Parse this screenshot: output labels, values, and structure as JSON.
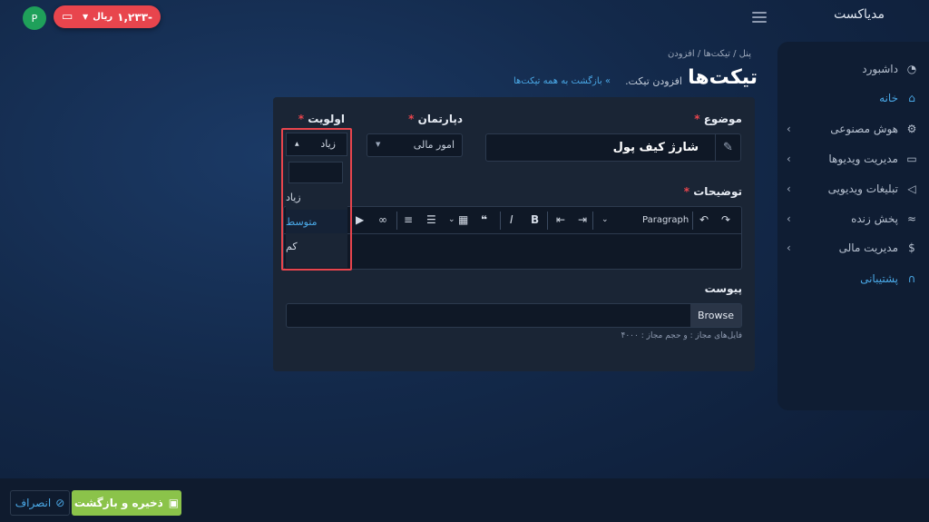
{
  "topbar": {
    "avatar_letter": "P",
    "wallet_amount": "-۱,۲۳۳",
    "wallet_currency": "ریال",
    "brand": "مدیاکست"
  },
  "sidebar": {
    "items": [
      {
        "label": "داشبورد",
        "icon": "speedometer-icon"
      },
      {
        "label": "خانه",
        "icon": "home-icon",
        "active": true
      },
      {
        "label": "هوش مصنوعی",
        "icon": "robot-icon",
        "has_chevron": true
      },
      {
        "label": "مدیریت ویدیوها",
        "icon": "video-camera-icon",
        "has_chevron": true
      },
      {
        "label": "تبلیغات ویدیویی",
        "icon": "megaphone-icon",
        "has_chevron": true
      },
      {
        "label": "پخش زنده",
        "icon": "wifi-icon",
        "has_chevron": true
      },
      {
        "label": "مدیریت مالی",
        "icon": "dollar-icon",
        "has_chevron": true
      },
      {
        "label": "پشتیبانی",
        "icon": "headset-icon",
        "active": true
      }
    ]
  },
  "breadcrumb": {
    "items": [
      "پنل",
      "تیکت‌ها",
      "افزودن"
    ],
    "sep": "/"
  },
  "page": {
    "title": "تیکت‌ها",
    "subtitle": "افزودن تیکت.",
    "back_link": "بازگشت به همه تیکت‌ها"
  },
  "form": {
    "subject_label": "موضوع",
    "subject_value": "شارژ کیف پول",
    "department_label": "دپارتمان",
    "department_value": "امور مالی",
    "priority_label": "اولویت",
    "priority_value": "زیاد",
    "priority_options": [
      "زیاد",
      "متوسط",
      "کم"
    ],
    "description_label": "توضیحات",
    "attachment_label": "پیوست",
    "browse_label": "Browse",
    "file_hint": "فایل‌های مجاز : و حجم مجاز : ۴۰۰۰",
    "required_mark": "*",
    "editor_paragraph": "Paragraph"
  },
  "footer": {
    "save_label": "ذخیره و بازگشت",
    "cancel_label": "انصراف"
  },
  "colors": {
    "accent": "#4aa8e6",
    "danger": "#e8454d",
    "success": "#8bc34a"
  }
}
